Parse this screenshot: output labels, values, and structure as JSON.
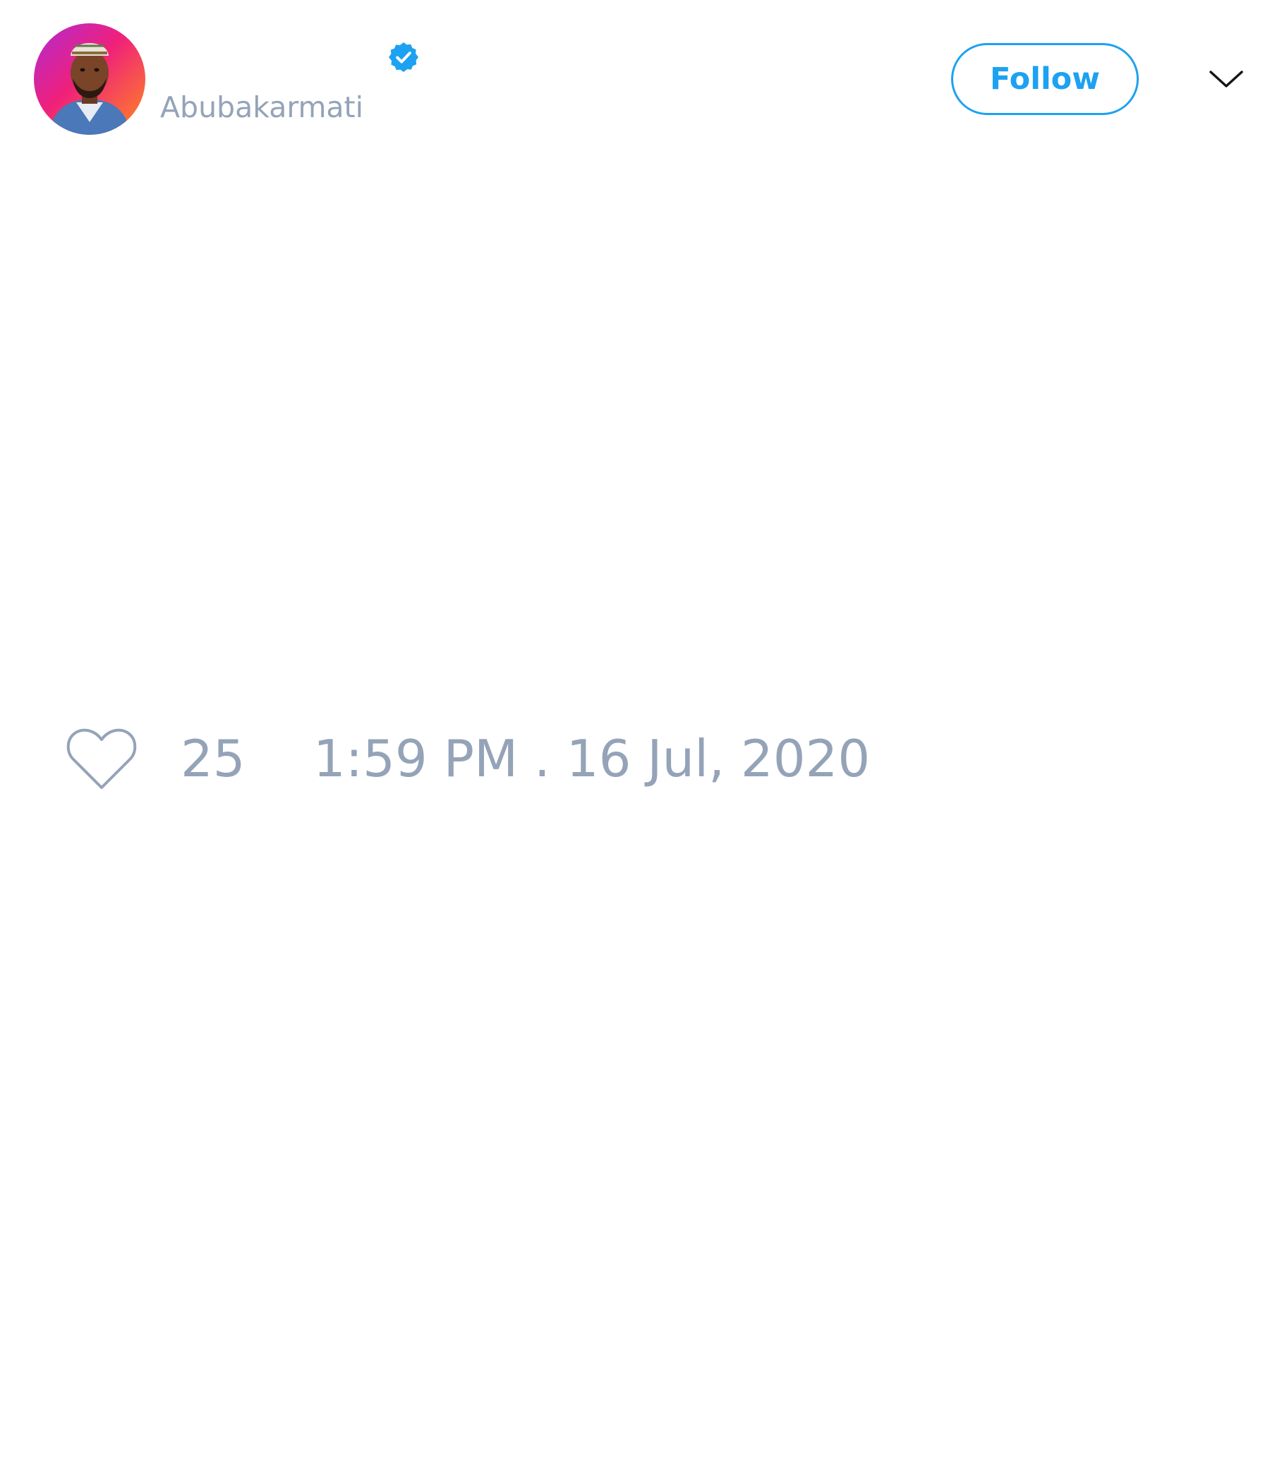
{
  "tweet": {
    "author": {
      "display_name": "",
      "handle": "Abubakarmati",
      "verified": true,
      "avatar_icon": "avatar-photo"
    },
    "follow_label": "Follow",
    "menu_icon": "chevron-down-icon",
    "like_icon": "heart-icon",
    "like_count": "25",
    "timestamp": "1:59 PM . 16 Jul, 2020"
  },
  "colors": {
    "accent": "#1da1f2",
    "muted_text": "#94a3b8",
    "background": "#ffffff"
  }
}
